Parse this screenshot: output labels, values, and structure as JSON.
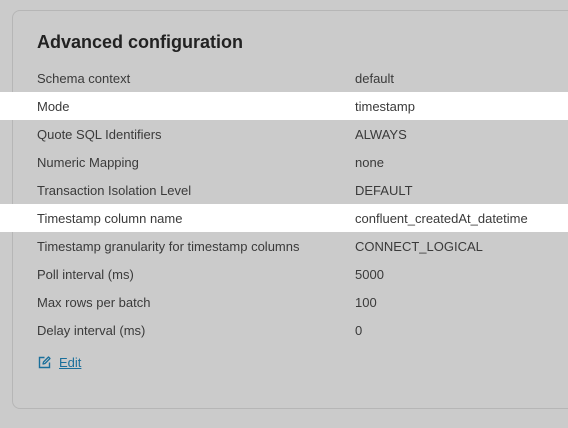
{
  "panel": {
    "title": "Advanced configuration",
    "rows": [
      {
        "label": "Schema context",
        "value": "default",
        "highlighted": false
      },
      {
        "label": "Mode",
        "value": "timestamp",
        "highlighted": true
      },
      {
        "label": "Quote SQL Identifiers",
        "value": "ALWAYS",
        "highlighted": false
      },
      {
        "label": "Numeric Mapping",
        "value": "none",
        "highlighted": false
      },
      {
        "label": "Transaction Isolation Level",
        "value": "DEFAULT",
        "highlighted": false
      },
      {
        "label": "Timestamp column name",
        "value": "confluent_createdAt_datetime",
        "highlighted": true
      },
      {
        "label": "Timestamp granularity for timestamp columns",
        "value": "CONNECT_LOGICAL",
        "highlighted": false
      },
      {
        "label": "Poll interval (ms)",
        "value": "5000",
        "highlighted": false
      },
      {
        "label": "Max rows per batch",
        "value": "100",
        "highlighted": false
      },
      {
        "label": "Delay interval (ms)",
        "value": "0",
        "highlighted": false
      }
    ],
    "edit": {
      "label": "Edit",
      "icon": "edit-icon"
    }
  },
  "colors": {
    "background": "#cbcbcb",
    "highlight_row": "#ffffff",
    "link": "#1a6f9b",
    "text": "#3a3a3a",
    "title": "#222222"
  }
}
